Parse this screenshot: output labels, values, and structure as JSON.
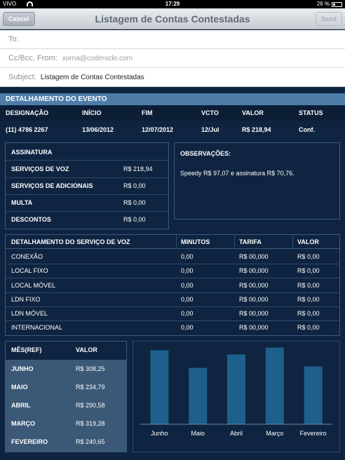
{
  "status_bar": {
    "carrier": "VIVO",
    "time": "17:29",
    "battery": "26 %"
  },
  "nav": {
    "title": "Listagem de Contas Contestadas",
    "cancel": "Cancel",
    "send": "Send"
  },
  "mail": {
    "to_label": "To:",
    "cc_label": "Cc/Bcc, From:",
    "from_value": "xorna@coderockr.com",
    "subject_label": "Subject:",
    "subject_value": "Listagem de Contas Contestadas"
  },
  "evento": {
    "title": "DETALHAMENTO DO EVENTO",
    "columns": [
      "DESIGNAÇÃO",
      "INÍCIO",
      "FIM",
      "VCTO",
      "VALOR",
      "STATUS"
    ],
    "row": [
      "(11) 4786 2267",
      "13/06/2012",
      "12/07/2012",
      "12/Jul",
      "R$ 218,94",
      "Conf."
    ]
  },
  "assinatura": {
    "title": "ASSINATURA",
    "items": [
      {
        "label": "SERVIÇOS DE VOZ",
        "value": "R$ 218,94"
      },
      {
        "label": "SERVIÇOS DE ADICIONAIS",
        "value": "R$ 0,00"
      },
      {
        "label": "MULTA",
        "value": "R$ 0,00"
      },
      {
        "label": "DESCONTOS",
        "value": "R$ 0,00"
      }
    ]
  },
  "observacoes": {
    "title": "OBSERVAÇÕES:",
    "text": "Speedy R$ 97,07 e assinatura R$ 70,76."
  },
  "voz": {
    "columns": [
      "DETALHAMENTO DO SERVIÇO DE VOZ",
      "MINUTOS",
      "TARIFA",
      "VALOR"
    ],
    "rows": [
      [
        "CONEXÃO",
        "0,00",
        "R$ 00,000",
        "R$ 0,00"
      ],
      [
        "LOCAL FIXO",
        "0,00",
        "R$ 00,000",
        "R$ 0,00"
      ],
      [
        "LOCAL MÓVEL",
        "0,00",
        "R$ 00,000",
        "R$ 0,00"
      ],
      [
        "LDN FIXO",
        "0,00",
        "R$ 00,000",
        "R$ 0,00"
      ],
      [
        "LDN MÓVEL",
        "0,00",
        "R$ 00,000",
        "R$ 0,00"
      ],
      [
        "INTERNACIONAL",
        "0,00",
        "R$ 00,000",
        "R$ 0,00"
      ]
    ]
  },
  "mensal": {
    "columns": [
      "MÊS(REF)",
      "VALOR"
    ],
    "rows": [
      [
        "JUNHO",
        "R$ 308,25"
      ],
      [
        "MAIO",
        "R$ 234,79"
      ],
      [
        "ABRIL",
        "R$ 290,58"
      ],
      [
        "MARÇO",
        "R$ 319,28"
      ],
      [
        "FEVEREIRO",
        "R$ 240,65"
      ]
    ]
  },
  "colors": {
    "accent": "#4d7da7",
    "bar": "#1e5f8c",
    "background": "#0f2440"
  },
  "chart_data": {
    "type": "bar",
    "categories": [
      "Junho",
      "Maio",
      "Abril",
      "Março",
      "Fevereiro"
    ],
    "values": [
      308.25,
      234.79,
      290.58,
      319.28,
      240.65
    ],
    "title": "",
    "xlabel": "",
    "ylabel": "",
    "ylim": [
      0,
      330
    ],
    "grid": false
  }
}
